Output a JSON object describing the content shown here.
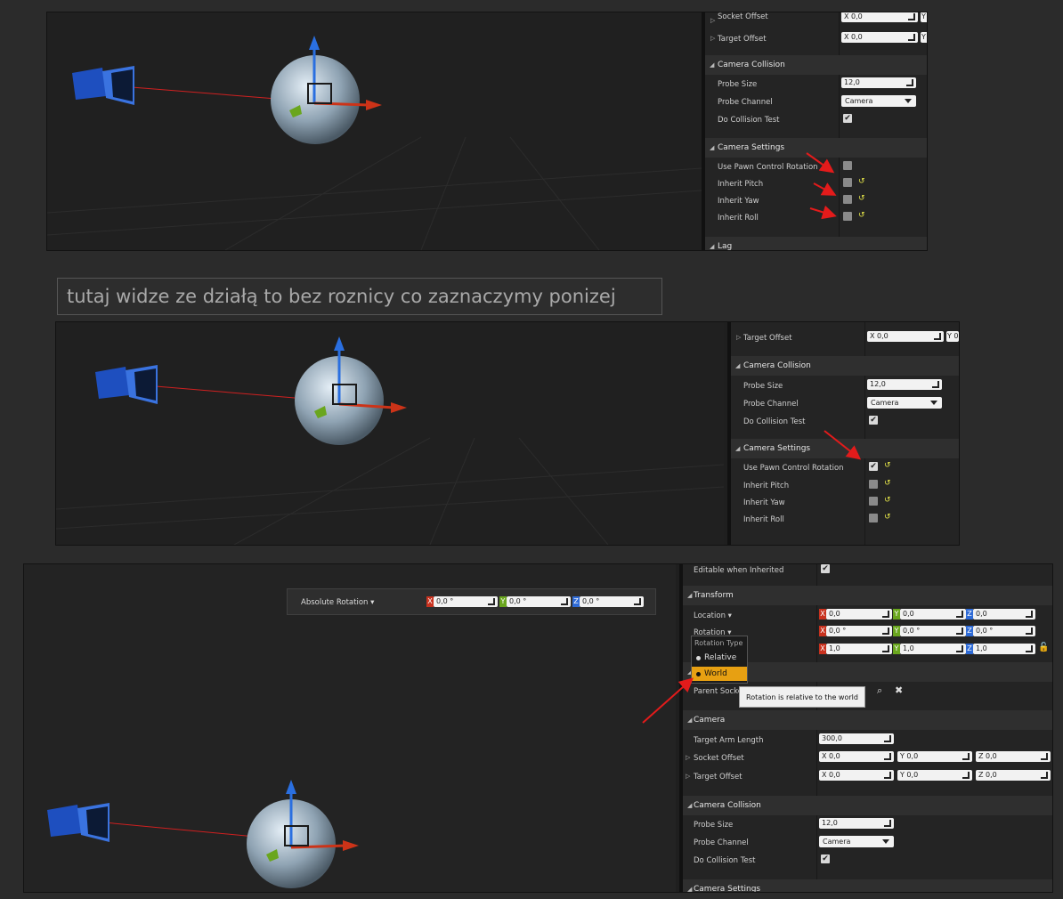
{
  "caption": "tutaj widze ze działą to bez roznicy co zaznaczymy ponizej",
  "panel1": {
    "socket_offset": {
      "label": "Socket Offset",
      "x": "X 0,0",
      "y": "Y"
    },
    "target_offset": {
      "label": "Target Offset",
      "x": "X 0,0",
      "y": "Y"
    },
    "camera_collision": "Camera Collision",
    "probe_size": {
      "label": "Probe Size",
      "value": "12,0"
    },
    "probe_channel": {
      "label": "Probe Channel",
      "value": "Camera"
    },
    "do_collision_test": {
      "label": "Do Collision Test",
      "checked": "✔"
    },
    "camera_settings": "Camera Settings",
    "use_pawn": "Use Pawn Control Rotation",
    "inherit_pitch": "Inherit Pitch",
    "inherit_yaw": "Inherit Yaw",
    "inherit_roll": "Inherit Roll",
    "lag": "Lag"
  },
  "panel2": {
    "target_offset": {
      "label": "Target Offset",
      "x": "X 0,0",
      "y": "Y 0"
    },
    "camera_collision": "Camera Collision",
    "probe_size": {
      "label": "Probe Size",
      "value": "12,0"
    },
    "probe_channel": {
      "label": "Probe Channel",
      "value": "Camera"
    },
    "do_collision_test": {
      "label": "Do Collision Test",
      "checked": "✔"
    },
    "camera_settings": "Camera Settings",
    "use_pawn": {
      "label": "Use Pawn Control Rotation",
      "checked": "✔"
    },
    "inherit_pitch": "Inherit Pitch",
    "inherit_yaw": "Inherit Yaw",
    "inherit_roll": "Inherit Roll"
  },
  "panel3": {
    "editable": {
      "label": "Editable when Inherited",
      "checked": "✔"
    },
    "transform": "Transform",
    "location": {
      "label": "Location ▾",
      "x": "0,0",
      "y": "0,0",
      "z": "0,0"
    },
    "rotation": {
      "label": "Rotation ▾",
      "x": "0,0 °",
      "y": "0,0 °",
      "z": "0,0 °"
    },
    "scale": {
      "x": "1,0",
      "y": "1,0",
      "z": "1,0"
    },
    "parent_socket": "Parent Socke",
    "camera": "Camera",
    "target_arm_length": {
      "label": "Target Arm Length",
      "value": "300,0"
    },
    "socket_offset": {
      "label": "Socket Offset",
      "x": "X 0,0",
      "y": "Y 0,0",
      "z": "Z 0,0"
    },
    "target_offset": {
      "label": "Target Offset",
      "x": "X 0,0",
      "y": "Y 0,0",
      "z": "Z 0,0"
    },
    "camera_collision": "Camera Collision",
    "probe_size": {
      "label": "Probe Size",
      "value": "12,0"
    },
    "probe_channel": {
      "label": "Probe Channel",
      "value": "Camera"
    },
    "do_collision_test": {
      "label": "Do Collision Test",
      "checked": "✔"
    },
    "camera_settings": "Camera Settings"
  },
  "absolute_rotation": {
    "label": "Absolute Rotation ▾",
    "x": "0,0 °",
    "y": "0,0 °",
    "z": "0,0 °"
  },
  "rotation_popup": {
    "title": "Rotation Type",
    "relative": "Relative",
    "world": "World"
  },
  "tooltip": "Rotation is relative to the world",
  "axis": {
    "x": "X",
    "y": "Y",
    "z": "Z"
  },
  "icons": {
    "search": "search-icon",
    "clear": "close-icon",
    "lock": "lock-icon",
    "reset": "reset-arrow-icon"
  },
  "colors": {
    "accent": "#e7a012",
    "annotation": "#e31b1b",
    "x_axis": "#c8321f",
    "y_axis": "#6aa61e",
    "z_axis": "#2f6bd6"
  }
}
